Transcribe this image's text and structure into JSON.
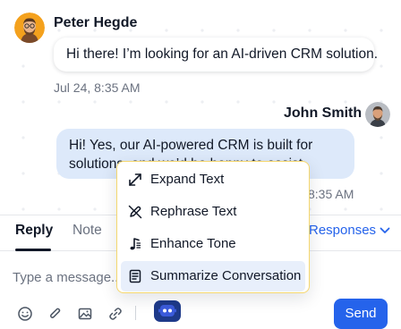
{
  "conversation": {
    "incoming": {
      "sender": "Peter Hegde",
      "text": "Hi there! I’m looking for an AI-driven CRM solution.",
      "time": "Jul 24, 8:35 AM"
    },
    "outgoing": {
      "sender": "John Smith",
      "text": "Hi! Yes, our AI-powered CRM is built for solutions, and we’d be happy to assist.",
      "time": "Jul 24, 8:35 AM",
      "time_visible": "8:35 AM"
    }
  },
  "ai_menu": {
    "items": [
      {
        "label": "Expand Text",
        "icon": "expand-arrows-icon"
      },
      {
        "label": "Rephrase Text",
        "icon": "pen-slash-icon"
      },
      {
        "label": "Enhance Tone",
        "icon": "music-note-icon"
      },
      {
        "label": "Summarize Conversation",
        "icon": "document-list-icon"
      }
    ],
    "active_index": 3
  },
  "composer": {
    "tabs": [
      {
        "label": "Reply",
        "active": true
      },
      {
        "label": "Note",
        "active": false
      }
    ],
    "responses_label": "Responses",
    "placeholder": "Type a message...",
    "send_label": "Send",
    "toolbar_icons": [
      "emoji-icon",
      "attachment-icon",
      "image-icon",
      "link-icon",
      "ai-assistant-icon"
    ]
  },
  "colors": {
    "accent": "#2563eb",
    "outgoing_bubble": "#dde9fa",
    "menu_border": "#f5d76e",
    "menu_active": "#e8effb",
    "ai_button": "#1e3a8a"
  }
}
